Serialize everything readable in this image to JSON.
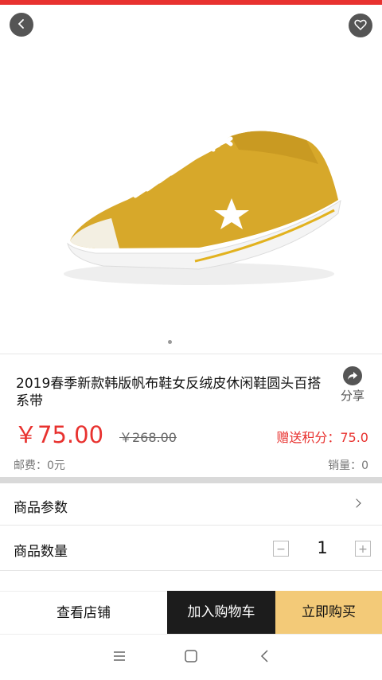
{
  "product": {
    "title": "2019春季新款韩版帆布鞋女反绒皮休闲鞋圆头百搭系带",
    "price": "￥75.00",
    "original_price": "￥268.00",
    "bonus_points": "赠送积分：75.0",
    "postage": "邮费：0元",
    "sales": "销量：0",
    "image_icon": "yellow-suede-sneaker-image"
  },
  "share": {
    "label": "分享"
  },
  "rows": {
    "params_label": "商品参数",
    "quantity_label": "商品数量",
    "quantity_value": "1",
    "minus_symbol": "−",
    "plus_symbol": "+"
  },
  "actions": {
    "view_store": "查看店铺",
    "add_to_cart": "加入购物车",
    "buy_now": "立即购买"
  },
  "colors": {
    "accent_red": "#e8322f",
    "cart_black": "#1c1c1c",
    "buy_gold": "#f3ca78"
  }
}
